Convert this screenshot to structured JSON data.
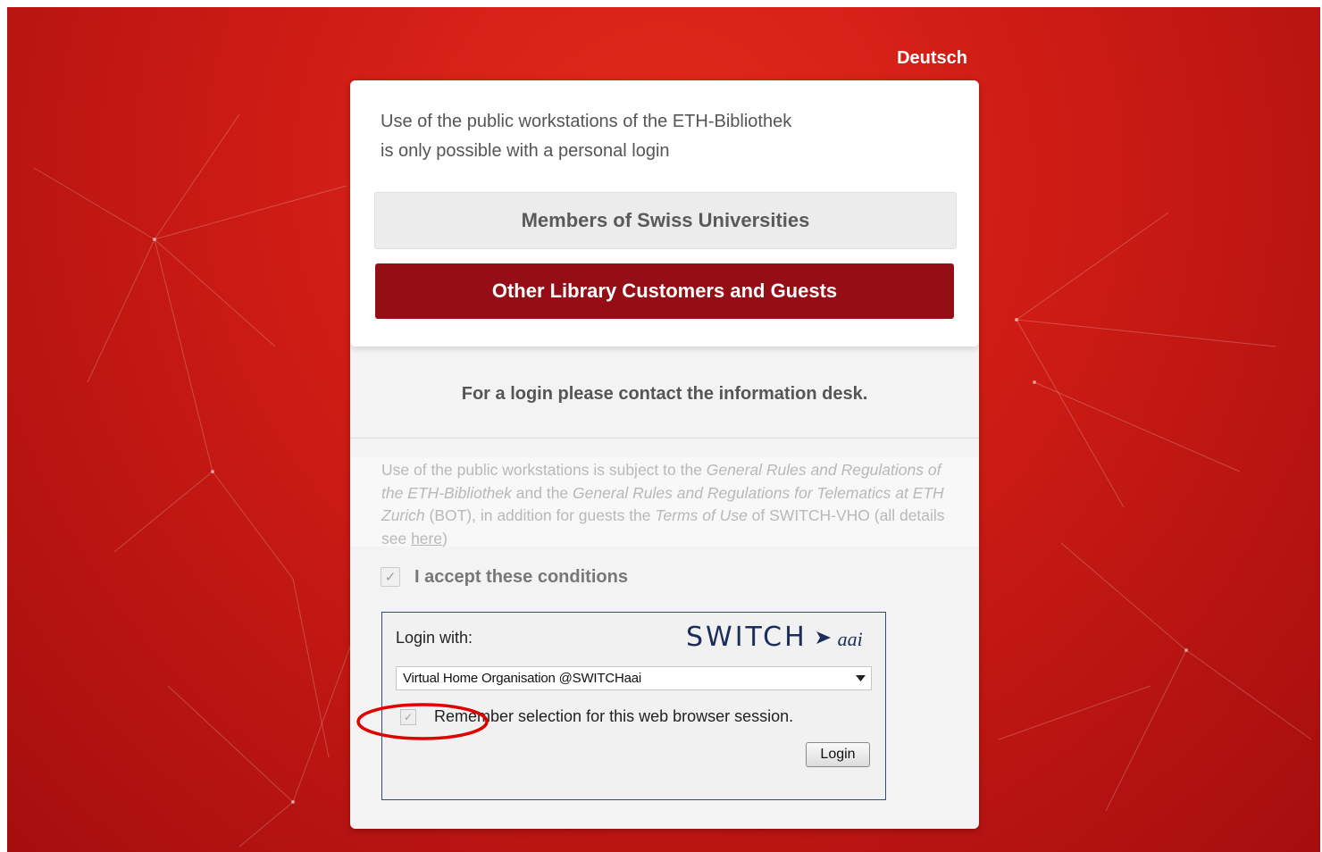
{
  "language_link": "Deutsch",
  "intro": {
    "line1": "Use of the public workstations of the ETH-Bibliothek",
    "line2": "is only possible with a personal login"
  },
  "buttons": {
    "members": "Members of Swiss Universities",
    "guests": "Other Library Customers and Guests"
  },
  "contact_text": "For a login please contact the information desk.",
  "terms": {
    "t1": "Use of the public workstations is subject to the ",
    "link1": "General Rules and Regulations of the ETH-Bibliothek",
    "t2": " and the ",
    "link2": "General Rules and Regulations for Telematics at ETH Zurich",
    "t3": " (BOT), in addition for guests the ",
    "link3": "Terms of Use",
    "t4": " of SWITCH-VHO (all details see ",
    "link4": "here",
    "t5": ")"
  },
  "accept": {
    "label": "I accept these conditions",
    "checked": true
  },
  "login_box": {
    "login_with": "Login with:",
    "logo_text": "SWITCH",
    "logo_suffix": "aai",
    "selected_org": "Virtual Home Organisation @SWITCHaai",
    "remember_label": "Remember selection for this web browser session.",
    "remember_checked": true,
    "login_button": "Login"
  },
  "colors": {
    "background_red": "#cc1b14",
    "guest_button": "#950d15",
    "highlight_ellipse": "#e00000",
    "switch_blue": "#1b2d5c"
  },
  "icons": {
    "checkmark": "check-icon",
    "dropdown": "chevron-down-icon",
    "logo_arrow": "arrow-right-icon"
  }
}
